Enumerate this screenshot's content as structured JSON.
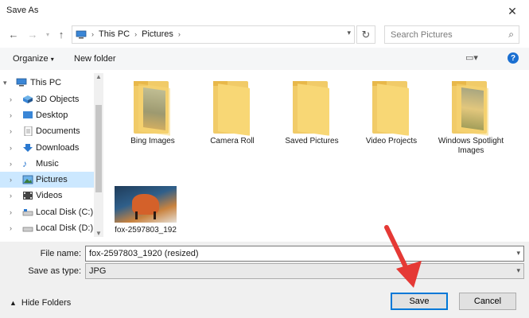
{
  "window": {
    "title": "Save As"
  },
  "nav": {
    "path": [
      "This PC",
      "Pictures"
    ],
    "search_placeholder": "Search Pictures"
  },
  "toolbar": {
    "organize": "Organize",
    "new_folder": "New folder"
  },
  "tree": [
    {
      "label": "This PC",
      "icon": "pc-icon"
    },
    {
      "label": "3D Objects",
      "icon": "cube-icon"
    },
    {
      "label": "Desktop",
      "icon": "desktop-icon"
    },
    {
      "label": "Documents",
      "icon": "documents-icon"
    },
    {
      "label": "Downloads",
      "icon": "downloads-icon"
    },
    {
      "label": "Music",
      "icon": "music-icon"
    },
    {
      "label": "Pictures",
      "icon": "pictures-icon"
    },
    {
      "label": "Videos",
      "icon": "videos-icon"
    },
    {
      "label": "Local Disk (C:)",
      "icon": "disk-icon"
    },
    {
      "label": "Local Disk (D:)",
      "icon": "disk-icon"
    }
  ],
  "files": [
    {
      "name": "Bing Images"
    },
    {
      "name": "Camera Roll"
    },
    {
      "name": "Saved Pictures"
    },
    {
      "name": "Video Projects"
    },
    {
      "name": "Windows Spotlight Images"
    },
    {
      "name": "fox-2597803_192"
    }
  ],
  "form": {
    "file_name_label": "File name:",
    "file_name_value": "fox-2597803_1920 (resized)",
    "save_type_label": "Save as type:",
    "save_type_value": "JPG"
  },
  "footer": {
    "hide_folders": "Hide Folders",
    "save": "Save",
    "cancel": "Cancel"
  },
  "colors": {
    "accent": "#0078d7",
    "selection": "#cce8ff",
    "arrow": "#e53935",
    "folder": "#f8d775"
  }
}
